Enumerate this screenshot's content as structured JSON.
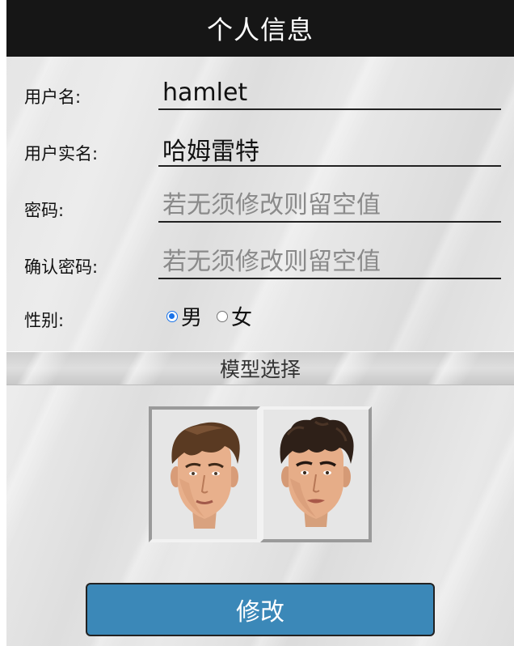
{
  "header": {
    "title": "个人信息"
  },
  "form": {
    "username": {
      "label": "用户名:",
      "value": "hamlet"
    },
    "realname": {
      "label": "用户实名:",
      "value": "哈姆雷特"
    },
    "password": {
      "label": "密码:",
      "placeholder": "若无须修改则留空值"
    },
    "confirm": {
      "label": "确认密码:",
      "placeholder": "若无须修改则留空值"
    },
    "gender": {
      "label": "性别:",
      "options": [
        {
          "label": "男",
          "checked": true
        },
        {
          "label": "女",
          "checked": false
        }
      ]
    }
  },
  "model": {
    "section_title": "模型选择",
    "options": [
      {
        "icon": "male-face-model-1-icon",
        "selected": true
      },
      {
        "icon": "male-face-model-2-icon",
        "selected": false
      }
    ]
  },
  "actions": {
    "submit_label": "修改"
  },
  "colors": {
    "header_bg": "#161616",
    "accent": "#3b88b8",
    "radio_checked": "#1a73e8",
    "placeholder": "#8a8a8a"
  }
}
